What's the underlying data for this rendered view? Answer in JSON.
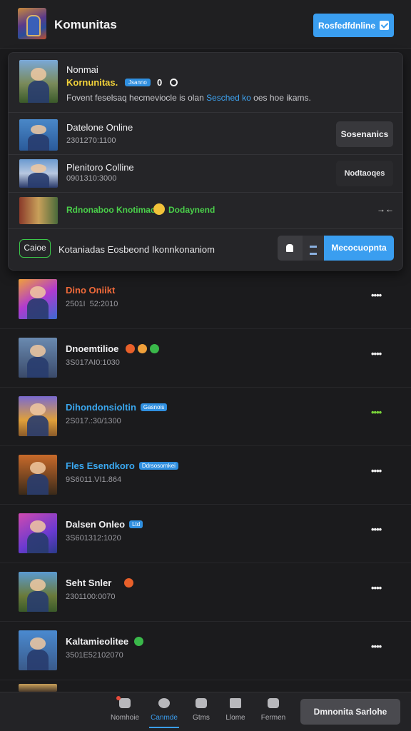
{
  "header": {
    "title": "Komunitas",
    "online_button": "Rosfedfdnline"
  },
  "panel": {
    "featured": {
      "line1": "Nonmai",
      "line2": "Kornunitas.",
      "badge": "Jsanno",
      "count": "0",
      "desc_prefix": "Fovent feselsaq hecmeviocle is olan ",
      "desc_link": "Sesched ko",
      "desc_suffix": " oes hoe ikams."
    },
    "rows": [
      {
        "name": "Datelone Online",
        "meta": "2301270:1100",
        "button": "Sosenanics"
      },
      {
        "name": "Plenitoro Colline",
        "meta": "0901310:3000",
        "button": "Nodtaoqes"
      }
    ],
    "highlight": {
      "text1": "Rdnonaboo Knotimaoe",
      "text2": "Dodaynend",
      "arrows": "→←"
    },
    "footer": {
      "chip": "Caioe",
      "desc": "Kotaniadas Eosbeond Ikonnkonaniom",
      "primary": "Mecocuopnta"
    }
  },
  "list": [
    {
      "name": "Dino Oniikt",
      "meta": "2501I  52:2010",
      "name_color": "#f06a3a",
      "tag": "",
      "more": "••••",
      "more_color": "#f0f0f0"
    },
    {
      "name": "Dnoemtilioe",
      "meta": "3S017AI0:1030",
      "name_color": "#f0f0f2",
      "tag": "",
      "more": "••••",
      "more_color": "#f0f0f0"
    },
    {
      "name": "Dihondonsioltin",
      "meta": "2S017.:30/1300",
      "name_color": "#3aa8f0",
      "tag": "Gasnois",
      "more": "••••",
      "more_color": "#7ad43a"
    },
    {
      "name": "Fles Esendkoro",
      "meta": "9S6011.VI1.864",
      "name_color": "#3aa8f0",
      "tag": "Ddrsosornkei",
      "more": "••••",
      "more_color": "#f0f0f0"
    },
    {
      "name": "Dalsen Onleo",
      "meta": "3S601312:1020",
      "name_color": "#f0f0f2",
      "tag": "Ltd",
      "more": "••••",
      "more_color": "#f0f0f0"
    },
    {
      "name": "Seht Snler",
      "meta": "2301100:0070",
      "name_color": "#f0f0f2",
      "tag": "",
      "more": "••••",
      "more_color": "#f0f0f0"
    },
    {
      "name": "Kaltamieolitee",
      "meta": "3501E52102070",
      "name_color": "#f0f0f2",
      "tag": "",
      "more": "••••",
      "more_color": "#f0f0f0"
    }
  ],
  "bottom_nav": {
    "items": [
      {
        "label": "Nomhoie",
        "icon": "home-icon"
      },
      {
        "label": "Canmde",
        "icon": "chat-icon"
      },
      {
        "label": "Gtms",
        "icon": "games-icon"
      },
      {
        "label": "Llome",
        "icon": "mail-icon"
      },
      {
        "label": "Fermen",
        "icon": "friends-icon"
      }
    ],
    "cta": "Dmnonita Sarlohe"
  },
  "colors": {
    "accent": "#3a9ef0",
    "positive": "#4ad04a",
    "warning": "#f2d23a"
  }
}
